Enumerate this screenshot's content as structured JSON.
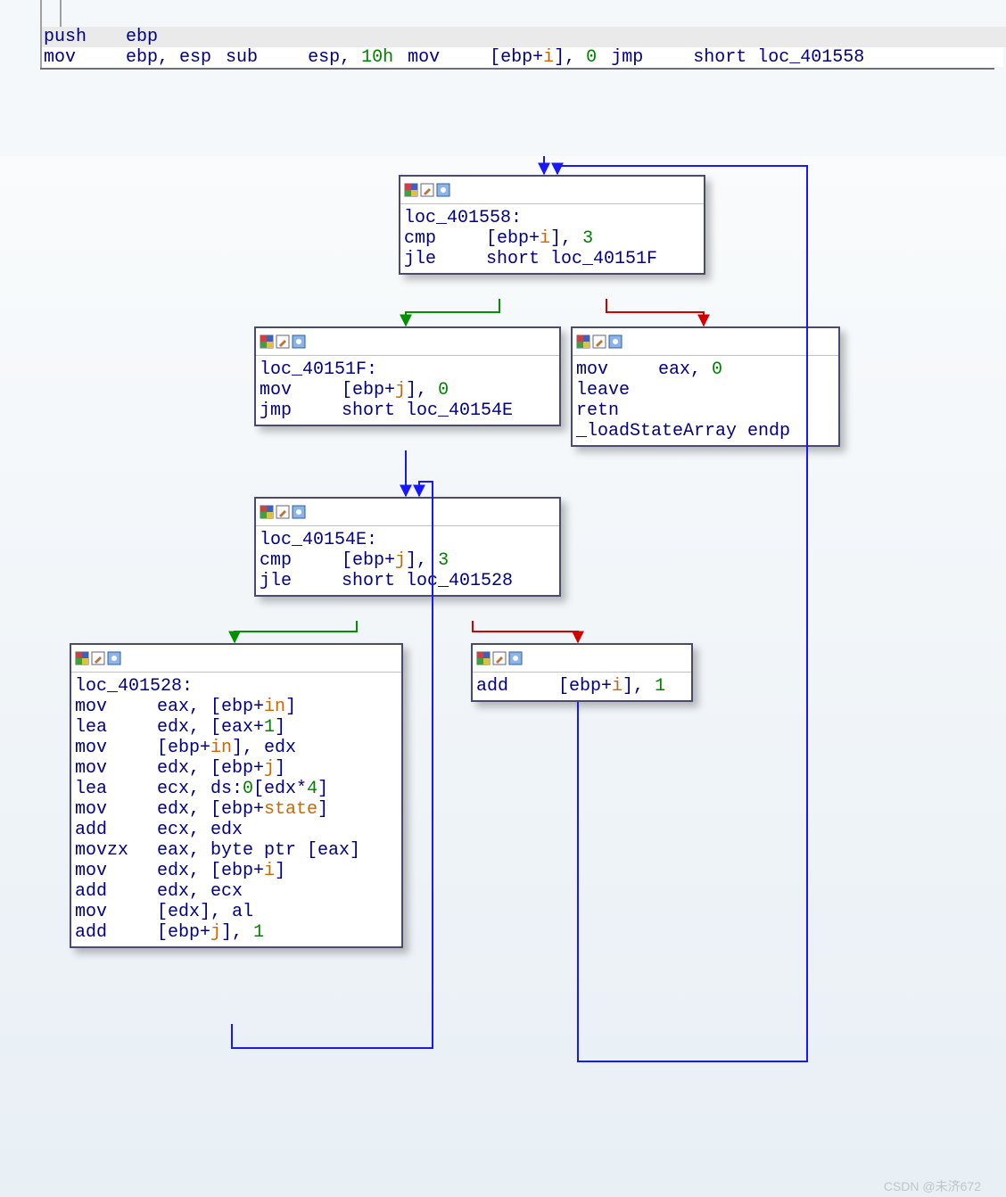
{
  "top_block": {
    "lines": [
      {
        "mnem": "push",
        "ops": [
          {
            "t": "txt",
            "s": "ebp"
          }
        ],
        "hl": true
      },
      {
        "mnem": "mov",
        "ops": [
          {
            "t": "txt",
            "s": "ebp, esp"
          }
        ]
      },
      {
        "mnem": "sub",
        "ops": [
          {
            "t": "txt",
            "s": "esp, "
          },
          {
            "t": "num",
            "s": "10h"
          }
        ]
      },
      {
        "mnem": "mov",
        "ops": [
          {
            "t": "txt",
            "s": "[ebp+"
          },
          {
            "t": "var",
            "s": "i"
          },
          {
            "t": "txt",
            "s": "], "
          },
          {
            "t": "num",
            "s": "0"
          }
        ]
      },
      {
        "mnem": "jmp",
        "ops": [
          {
            "t": "txt",
            "s": "short loc_401558"
          }
        ]
      }
    ]
  },
  "nodes": {
    "n1": {
      "label": "loc_401558:",
      "lines": [
        {
          "mnem": "cmp",
          "ops": [
            {
              "t": "txt",
              "s": "[ebp+"
            },
            {
              "t": "var",
              "s": "i"
            },
            {
              "t": "txt",
              "s": "], "
            },
            {
              "t": "num",
              "s": "3"
            }
          ]
        },
        {
          "mnem": "jle",
          "ops": [
            {
              "t": "txt",
              "s": "short loc_40151F"
            }
          ]
        }
      ]
    },
    "n2": {
      "label": "loc_40151F:",
      "lines": [
        {
          "mnem": "mov",
          "ops": [
            {
              "t": "txt",
              "s": "[ebp+"
            },
            {
              "t": "var",
              "s": "j"
            },
            {
              "t": "txt",
              "s": "], "
            },
            {
              "t": "num",
              "s": "0"
            }
          ]
        },
        {
          "mnem": "jmp",
          "ops": [
            {
              "t": "txt",
              "s": "short loc_40154E"
            }
          ]
        }
      ]
    },
    "n3": {
      "lines": [
        {
          "mnem": "mov",
          "ops": [
            {
              "t": "txt",
              "s": "eax, "
            },
            {
              "t": "num",
              "s": "0"
            }
          ]
        },
        {
          "mnem": "leave",
          "ops": []
        },
        {
          "mnem": "retn",
          "ops": []
        },
        {
          "mnem_color": "#000080",
          "mnem": "_loadStateArray",
          "ops": [
            {
              "t": "txt",
              "s": " endp"
            }
          ],
          "same_line": true
        }
      ]
    },
    "n4": {
      "label": "loc_40154E:",
      "lines": [
        {
          "mnem": "cmp",
          "ops": [
            {
              "t": "txt",
              "s": "[ebp+"
            },
            {
              "t": "var",
              "s": "j"
            },
            {
              "t": "txt",
              "s": "], "
            },
            {
              "t": "num",
              "s": "3"
            }
          ]
        },
        {
          "mnem": "jle",
          "ops": [
            {
              "t": "txt",
              "s": "short loc_401528"
            }
          ]
        }
      ]
    },
    "n5": {
      "label": "loc_401528:",
      "lines": [
        {
          "mnem": "mov",
          "ops": [
            {
              "t": "txt",
              "s": "eax, [ebp+"
            },
            {
              "t": "var",
              "s": "in"
            },
            {
              "t": "txt",
              "s": "]"
            }
          ]
        },
        {
          "mnem": "lea",
          "ops": [
            {
              "t": "txt",
              "s": "edx, [eax+"
            },
            {
              "t": "num",
              "s": "1"
            },
            {
              "t": "txt",
              "s": "]"
            }
          ]
        },
        {
          "mnem": "mov",
          "ops": [
            {
              "t": "txt",
              "s": "[ebp+"
            },
            {
              "t": "var",
              "s": "in"
            },
            {
              "t": "txt",
              "s": "], edx"
            }
          ]
        },
        {
          "mnem": "mov",
          "ops": [
            {
              "t": "txt",
              "s": "edx, [ebp+"
            },
            {
              "t": "var",
              "s": "j"
            },
            {
              "t": "txt",
              "s": "]"
            }
          ]
        },
        {
          "mnem": "lea",
          "ops": [
            {
              "t": "txt",
              "s": "ecx, ds:"
            },
            {
              "t": "num",
              "s": "0"
            },
            {
              "t": "txt",
              "s": "[edx*"
            },
            {
              "t": "num",
              "s": "4"
            },
            {
              "t": "txt",
              "s": "]"
            }
          ]
        },
        {
          "mnem": "mov",
          "ops": [
            {
              "t": "txt",
              "s": "edx, [ebp+"
            },
            {
              "t": "var",
              "s": "state"
            },
            {
              "t": "txt",
              "s": "]"
            }
          ]
        },
        {
          "mnem": "add",
          "ops": [
            {
              "t": "txt",
              "s": "ecx, edx"
            }
          ]
        },
        {
          "mnem": "movzx",
          "ops": [
            {
              "t": "txt",
              "s": "eax, byte ptr [eax]"
            }
          ]
        },
        {
          "mnem": "mov",
          "ops": [
            {
              "t": "txt",
              "s": "edx, [ebp+"
            },
            {
              "t": "var",
              "s": "i"
            },
            {
              "t": "txt",
              "s": "]"
            }
          ]
        },
        {
          "mnem": "add",
          "ops": [
            {
              "t": "txt",
              "s": "edx, ecx"
            }
          ]
        },
        {
          "mnem": "mov",
          "ops": [
            {
              "t": "txt",
              "s": "[edx], al"
            }
          ]
        },
        {
          "mnem": "add",
          "ops": [
            {
              "t": "txt",
              "s": "[ebp+"
            },
            {
              "t": "var",
              "s": "j"
            },
            {
              "t": "txt",
              "s": "], "
            },
            {
              "t": "num",
              "s": "1"
            }
          ]
        }
      ]
    },
    "n6": {
      "lines": [
        {
          "mnem": "add",
          "ops": [
            {
              "t": "txt",
              "s": "[ebp+"
            },
            {
              "t": "var",
              "s": "i"
            },
            {
              "t": "txt",
              "s": "], "
            },
            {
              "t": "num",
              "s": "1"
            }
          ]
        }
      ]
    }
  },
  "watermark": "CSDN @未济672"
}
